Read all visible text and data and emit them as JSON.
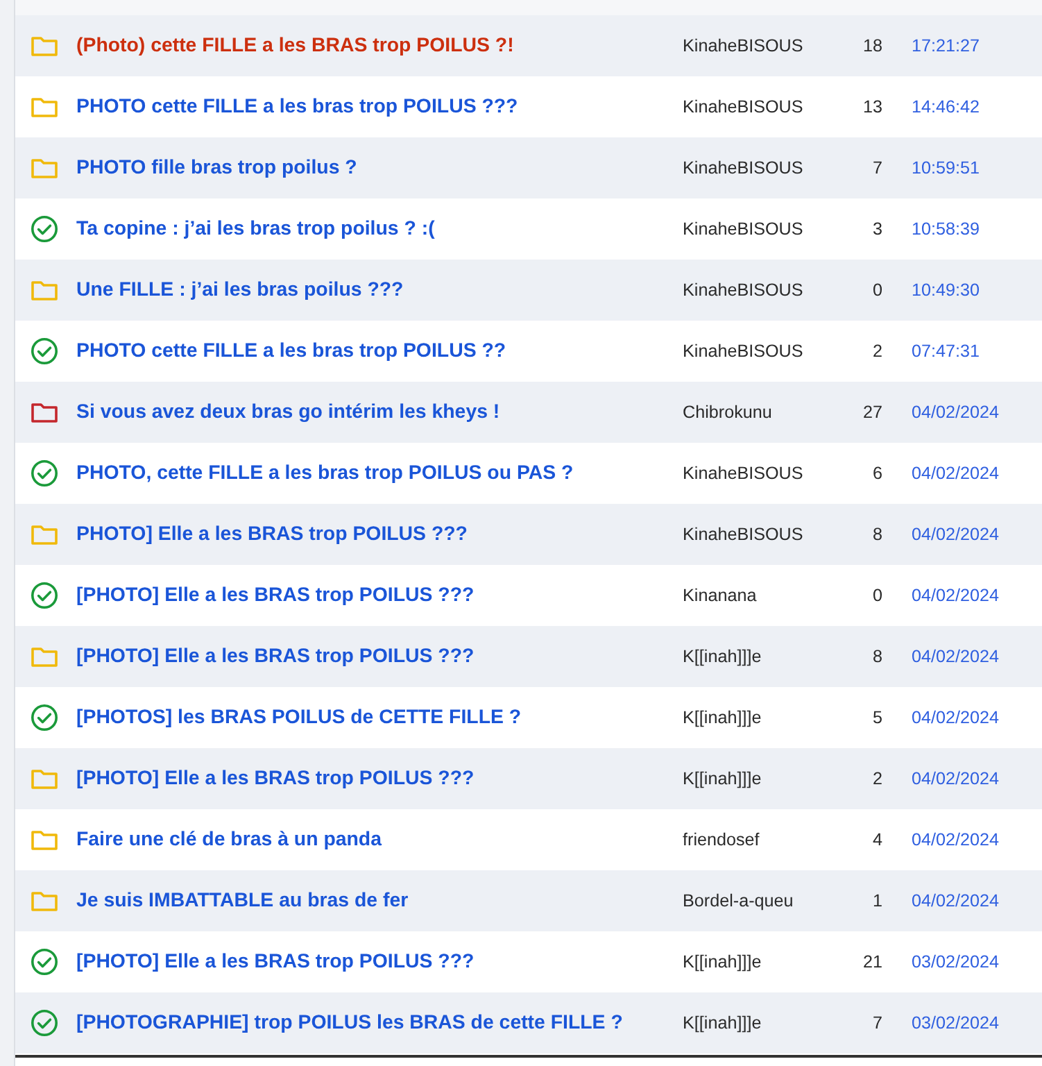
{
  "topics": [
    {
      "kind": "folder",
      "highlighted": true,
      "title": "(Photo) cette FILLE a les BRAS trop POILUS ?!",
      "author": "KinaheBISOUS",
      "replies": "18",
      "last": "17:21:27"
    },
    {
      "kind": "folder",
      "highlighted": false,
      "title": "PHOTO cette FILLE a les bras trop POILUS ???",
      "author": "KinaheBISOUS",
      "replies": "13",
      "last": "14:46:42"
    },
    {
      "kind": "folder",
      "highlighted": false,
      "title": "PHOTO fille bras trop poilus ?",
      "author": "KinaheBISOUS",
      "replies": "7",
      "last": "10:59:51"
    },
    {
      "kind": "resolved",
      "highlighted": false,
      "title": "Ta copine : j’ai les bras trop poilus ? :(",
      "author": "KinaheBISOUS",
      "replies": "3",
      "last": "10:58:39"
    },
    {
      "kind": "folder",
      "highlighted": false,
      "title": "Une FILLE : j’ai les bras poilus ???",
      "author": "KinaheBISOUS",
      "replies": "0",
      "last": "10:49:30"
    },
    {
      "kind": "resolved",
      "highlighted": false,
      "title": "PHOTO cette FILLE a les bras trop POILUS ??",
      "author": "KinaheBISOUS",
      "replies": "2",
      "last": "07:47:31"
    },
    {
      "kind": "hot",
      "highlighted": false,
      "title": "Si vous avez deux bras go intérim les kheys !",
      "author": "Chibrokunu",
      "replies": "27",
      "last": "04/02/2024"
    },
    {
      "kind": "resolved",
      "highlighted": false,
      "title": "PHOTO, cette FILLE a les bras trop POILUS ou PAS ?",
      "author": "KinaheBISOUS",
      "replies": "6",
      "last": "04/02/2024"
    },
    {
      "kind": "folder",
      "highlighted": false,
      "title": "PHOTO] Elle a les BRAS trop POILUS ???",
      "author": "KinaheBISOUS",
      "replies": "8",
      "last": "04/02/2024"
    },
    {
      "kind": "resolved",
      "highlighted": false,
      "title": "[PHOTO] Elle a les BRAS trop POILUS ???",
      "author": "Kinanana",
      "replies": "0",
      "last": "04/02/2024"
    },
    {
      "kind": "folder",
      "highlighted": false,
      "title": "[PHOTO] Elle a les BRAS trop POILUS ???",
      "author": "K[[inah]]]e",
      "replies": "8",
      "last": "04/02/2024"
    },
    {
      "kind": "resolved",
      "highlighted": false,
      "title": "[PHOTOS] les BRAS POILUS de CETTE FILLE ?",
      "author": "K[[inah]]]e",
      "replies": "5",
      "last": "04/02/2024"
    },
    {
      "kind": "folder",
      "highlighted": false,
      "title": "[PHOTO] Elle a les BRAS trop POILUS ???",
      "author": "K[[inah]]]e",
      "replies": "2",
      "last": "04/02/2024"
    },
    {
      "kind": "folder",
      "highlighted": false,
      "title": "Faire une clé de bras à un panda",
      "author": "friendosef",
      "replies": "4",
      "last": "04/02/2024"
    },
    {
      "kind": "folder",
      "highlighted": false,
      "title": "Je suis IMBATTABLE au bras de fer",
      "author": "Bordel-a-queu",
      "replies": "1",
      "last": "04/02/2024"
    },
    {
      "kind": "resolved",
      "highlighted": false,
      "title": "[PHOTO] Elle a les BRAS trop POILUS ???",
      "author": "K[[inah]]]e",
      "replies": "21",
      "last": "03/02/2024"
    },
    {
      "kind": "resolved",
      "highlighted": false,
      "title": "[PHOTOGRAPHIE] trop POILUS les BRAS de cette FILLE ?",
      "author": "K[[inah]]]e",
      "replies": "7",
      "last": "03/02/2024"
    }
  ]
}
